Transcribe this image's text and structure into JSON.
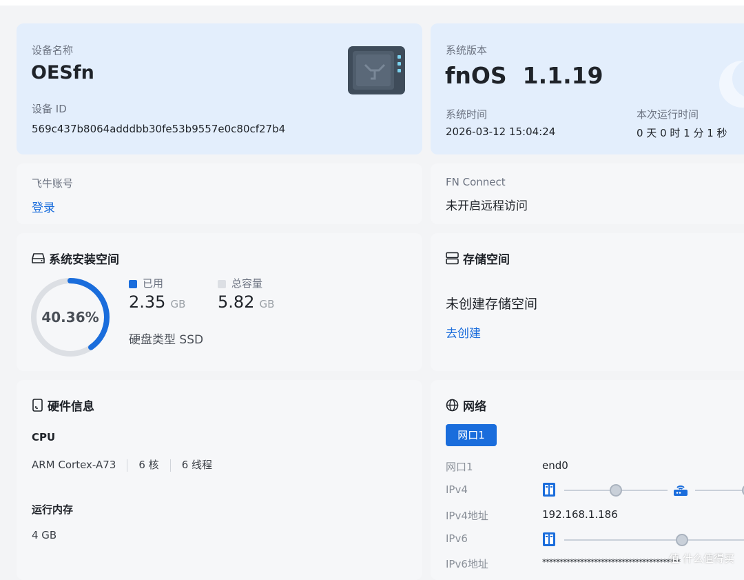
{
  "device": {
    "name_label": "设备名称",
    "name": "OESfn",
    "id_label": "设备 ID",
    "id": "569c437b8064adddbb30fe53b9557e0c80cf27b4"
  },
  "system": {
    "version_label": "系统版本",
    "version": "fnOS  1.1.19",
    "time_label": "系统时间",
    "time": "2026-03-12 15:04:24",
    "uptime_label": "本次运行时间",
    "uptime": "0 天 0 时 1 分 1 秒"
  },
  "account": {
    "label": "飞牛账号",
    "login": "登录"
  },
  "fn_connect": {
    "label": "FN Connect",
    "status": "未开启远程访问"
  },
  "system_space": {
    "title": "系统安装空间",
    "percent_text": "40.36%",
    "percent": 40.36,
    "used_label": "已用",
    "used_value": "2.35",
    "used_unit": "GB",
    "total_label": "总容量",
    "total_value": "5.82",
    "total_unit": "GB",
    "disk_type": "硬盘类型 SSD",
    "used_color": "#1a6ddc",
    "track_color": "#dcdfe4"
  },
  "storage": {
    "title": "存储空间",
    "status": "未创建存储空间",
    "create_link": "去创建"
  },
  "hardware": {
    "title": "硬件信息",
    "cpu_label": "CPU",
    "cpu_model": "ARM Cortex-A73",
    "cpu_cores": "6 核",
    "cpu_threads": "6 线程",
    "mem_label": "运行内存",
    "mem_value": "4 GB"
  },
  "network": {
    "title": "网络",
    "tab": "网口1",
    "rows": [
      {
        "label": "网口1",
        "value": "end0"
      },
      {
        "label": "IPv4",
        "value": ""
      },
      {
        "label": "IPv4地址",
        "value": "192.168.1.186"
      },
      {
        "label": "IPv6",
        "value": ""
      },
      {
        "label": "IPv6地址",
        "value": "****************************************"
      }
    ]
  },
  "watermark": "值 什么值得买"
}
